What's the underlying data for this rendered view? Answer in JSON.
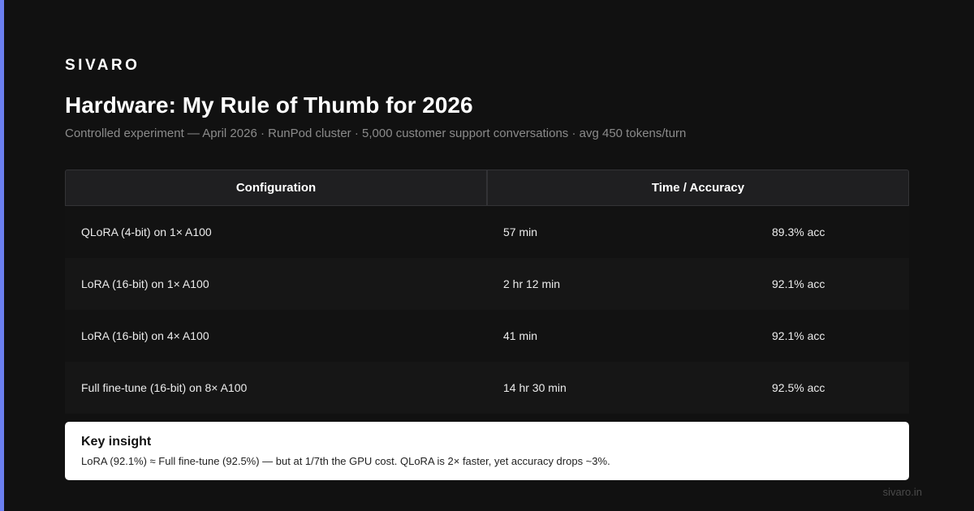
{
  "brand": "SIVARO",
  "title": "Hardware: My Rule of Thumb for 2026",
  "subtitle": "Controlled experiment — April 2026 · RunPod cluster · 5,000 customer support conversations · avg 450 tokens/turn",
  "table": {
    "headers": [
      "Configuration",
      "Time / Accuracy"
    ],
    "rows": [
      {
        "config": "QLoRA (4-bit) on 1× A100",
        "time": "57 min",
        "accuracy": "89.3% acc"
      },
      {
        "config": "LoRA (16-bit) on 1× A100",
        "time": "2 hr 12 min",
        "accuracy": "92.1% acc"
      },
      {
        "config": "LoRA (16-bit) on 4× A100",
        "time": "41 min",
        "accuracy": "92.1% acc"
      },
      {
        "config": "Full fine-tune (16-bit) on 8× A100",
        "time": "14 hr 30 min",
        "accuracy": "92.5% acc"
      }
    ]
  },
  "insight": {
    "title": "Key insight",
    "text": "LoRA (92.1%) ≈ Full fine-tune (92.5%) — but at 1/7th the GPU cost. QLoRA is 2× faster, yet accuracy drops ~3%."
  },
  "footer": "sivaro.in",
  "colors": {
    "background": "#111111",
    "accent": "#6b7ff0",
    "header_cell": "#1f1f21",
    "insight_card": "#ffffff"
  }
}
